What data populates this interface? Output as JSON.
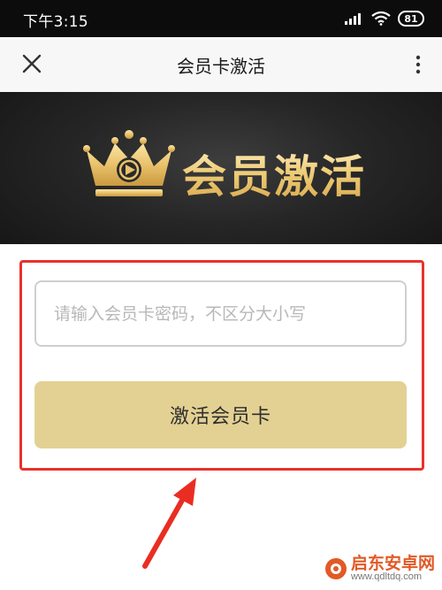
{
  "status_bar": {
    "time": "下午3:15",
    "battery": "81",
    "icons": [
      "signal-icon",
      "wifi-icon",
      "battery-icon"
    ]
  },
  "nav_bar": {
    "title": "会员卡激活",
    "close_icon": "close-icon",
    "more_icon": "more-vertical-icon"
  },
  "banner": {
    "logo_icon": "crown-play-icon",
    "text": "会员激活"
  },
  "form": {
    "code_placeholder": "请输入会员卡密码，不区分大小写",
    "code_value": "",
    "activate_label": "激活会员卡"
  },
  "colors": {
    "status_bar_bg": "#0c0c0c",
    "nav_bg": "#f7f7f7",
    "banner_gold": "#e9c26b",
    "button_bg": "#e3d193",
    "highlight_red": "#e8322c"
  },
  "watermark": {
    "site_name": "启东安卓网",
    "url": "www.qdltdq.com"
  }
}
